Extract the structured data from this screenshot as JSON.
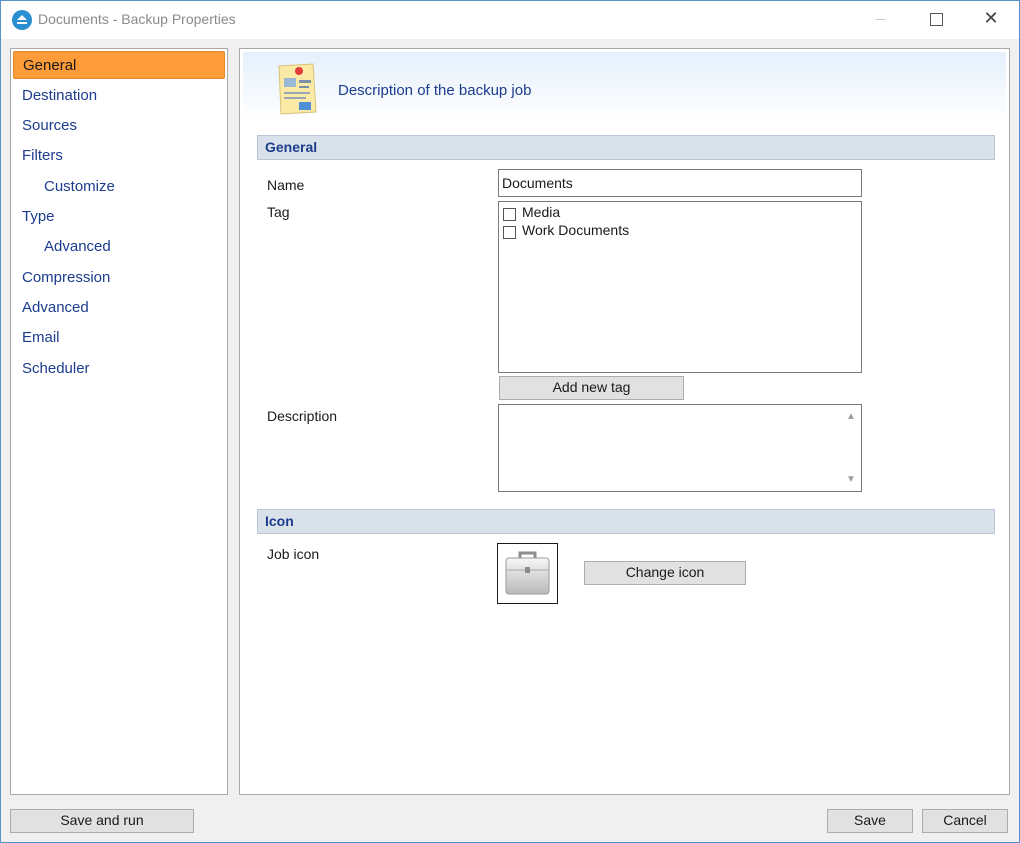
{
  "window": {
    "title": "Documents - Backup Properties",
    "close_glyph": "✕"
  },
  "sidebar": {
    "items": [
      {
        "label": "General",
        "active": true
      },
      {
        "label": "Destination"
      },
      {
        "label": "Sources"
      },
      {
        "label": "Filters"
      },
      {
        "label": "Customize"
      },
      {
        "label": "Type"
      },
      {
        "label": "Advanced"
      },
      {
        "label": "Compression"
      },
      {
        "label": "Advanced"
      },
      {
        "label": "Email"
      },
      {
        "label": "Scheduler"
      }
    ]
  },
  "banner": {
    "text": "Description of the backup job",
    "icon": "notes-icon"
  },
  "general": {
    "section_title": "General",
    "name_label": "Name",
    "name_value": "Documents",
    "tag_label": "Tag",
    "tags": [
      {
        "label": "Media",
        "checked": false
      },
      {
        "label": "Work Documents",
        "checked": false
      }
    ],
    "add_tag_button": "Add new tag",
    "description_label": "Description",
    "description_value": ""
  },
  "icon_section": {
    "section_title": "Icon",
    "job_icon_label": "Job icon",
    "job_icon": "briefcase-icon",
    "change_icon_button": "Change icon"
  },
  "footer": {
    "save_and_run": "Save and run",
    "save": "Save",
    "cancel": "Cancel"
  },
  "colors": {
    "accent": "#ff9c3a",
    "nav_text": "#1c3c8c",
    "section_bg": "#d9e1ea"
  }
}
